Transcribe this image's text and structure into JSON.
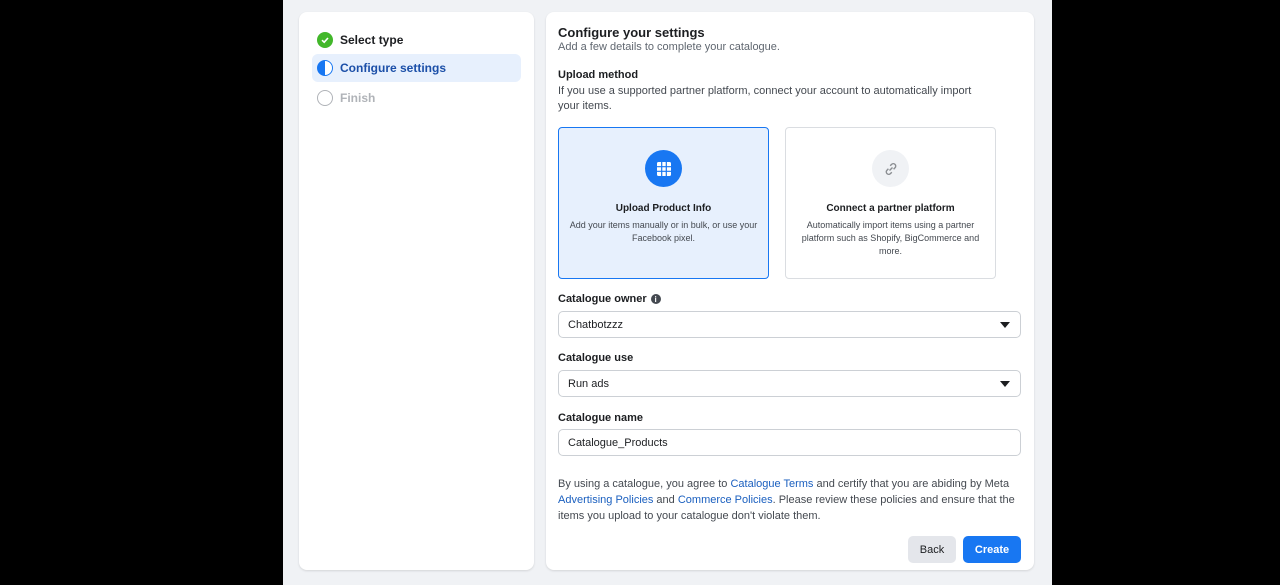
{
  "steps": [
    {
      "label": "Select type",
      "state": "done"
    },
    {
      "label": "Configure settings",
      "state": "active"
    },
    {
      "label": "Finish",
      "state": "todo"
    }
  ],
  "main": {
    "title": "Configure your settings",
    "subtitle": "Add a few details to complete your catalogue.",
    "upload": {
      "label": "Upload method",
      "description": "If you use a supported partner platform, connect your account to automatically import your items.",
      "options": [
        {
          "title": "Upload Product Info",
          "desc": "Add your items manually or in bulk, or use your Facebook pixel.",
          "icon": "grid-icon",
          "selected": true
        },
        {
          "title": "Connect a partner platform",
          "desc": "Automatically import items using a partner platform such as Shopify, BigCommerce and more.",
          "icon": "link-icon",
          "selected": false
        }
      ]
    },
    "owner": {
      "label": "Catalogue owner",
      "value": "Chatbotzzz"
    },
    "use": {
      "label": "Catalogue use",
      "value": "Run ads"
    },
    "name": {
      "label": "Catalogue name",
      "value": "Catalogue_Products"
    },
    "terms": {
      "t1": "By using a catalogue, you agree to ",
      "link1": "Catalogue Terms",
      "t2": " and certify that you are abiding by Meta ",
      "link2": "Advertising Policies",
      "t3": " and ",
      "link3": "Commerce Policies",
      "t4": ". Please review these policies and ensure that the items you upload to your catalogue don't violate them."
    },
    "buttons": {
      "back": "Back",
      "create": "Create"
    }
  },
  "colors": {
    "accent": "#1877f2",
    "success": "#42b72a"
  }
}
